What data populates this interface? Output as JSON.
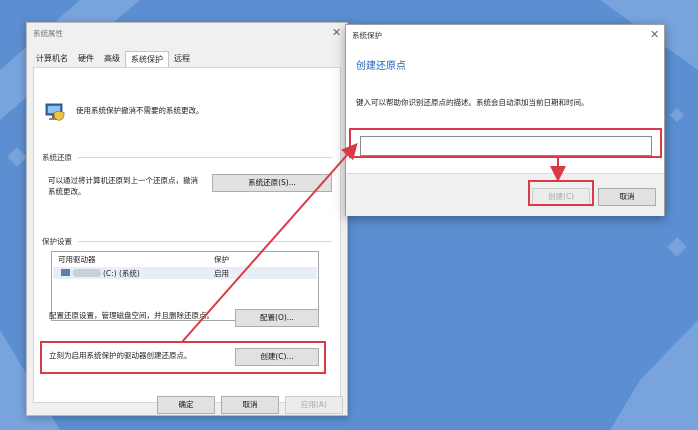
{
  "system_properties": {
    "title": "系统属性",
    "tabs": [
      "计算机名",
      "硬件",
      "高级",
      "系统保护",
      "远程"
    ],
    "intro": "使用系统保护撤消不需要的系统更改。",
    "restore_section": {
      "heading": "系统还原",
      "description_line1": "可以通过将计算机还原到上一个还原点，撤消",
      "description_line2": "系统更改。",
      "button": "系统还原(S)..."
    },
    "protection_section": {
      "heading": "保护设置",
      "columns": [
        "可用驱动器",
        "保护"
      ],
      "rows": [
        {
          "drive": "(C:) (系统)",
          "protection": "启用"
        }
      ],
      "configure_text": "配置还原设置，管理磁盘空间，并且删除还原点。",
      "configure_button": "配置(O)...",
      "create_text": "立刻为启用系统保护的驱动器创建还原点。",
      "create_button": "创建(C)..."
    },
    "footer_buttons": {
      "ok": "确定",
      "cancel": "取消",
      "apply": "应用(A)"
    }
  },
  "create_dialog": {
    "title": "系统保护",
    "heading": "创建还原点",
    "description": "键入可以帮助你识别还原点的描述。系统会自动添加当前日期和时间。",
    "input_value": "",
    "create_button": "创建(C)",
    "cancel_button": "取消"
  },
  "colors": {
    "accent_heading": "#1e62b8",
    "annotation_red": "#d83a48",
    "background": "#5b8fd1"
  }
}
